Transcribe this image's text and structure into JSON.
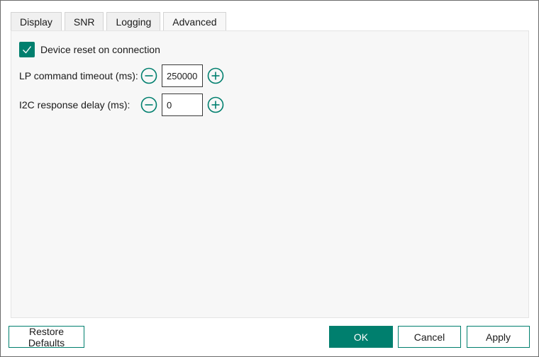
{
  "colors": {
    "accent": "#007f6e",
    "panel_bg": "#f7f7f7",
    "tab_bg": "#f0f0f0"
  },
  "tabs": [
    {
      "label": "Display",
      "active": false
    },
    {
      "label": "SNR",
      "active": false
    },
    {
      "label": "Logging",
      "active": false
    },
    {
      "label": "Advanced",
      "active": true
    }
  ],
  "advanced": {
    "device_reset": {
      "label": "Device reset on connection",
      "checked": true,
      "icon": "check-icon"
    },
    "lp_timeout": {
      "label": "LP command timeout (ms):",
      "value": "250000",
      "decrement_icon": "minus-circle-icon",
      "increment_icon": "plus-circle-icon"
    },
    "i2c_delay": {
      "label": "I2C response delay (ms):",
      "value": "0",
      "decrement_icon": "minus-circle-icon",
      "increment_icon": "plus-circle-icon"
    }
  },
  "buttons": {
    "restore_defaults": "Restore Defaults",
    "ok": "OK",
    "cancel": "Cancel",
    "apply": "Apply"
  }
}
